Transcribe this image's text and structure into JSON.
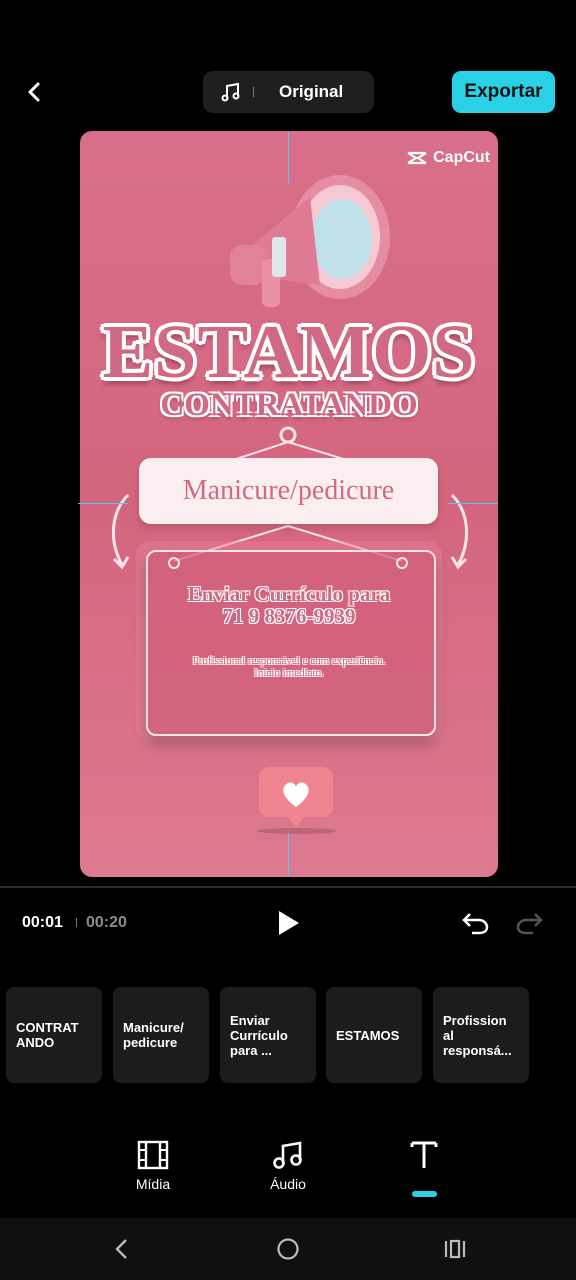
{
  "topbar": {
    "audio_label": "Original",
    "export_label": "Exportar"
  },
  "canvas": {
    "watermark": "CapCut",
    "headline": "ESTAMOS",
    "subheadline": "CONTRATANDO",
    "role": "Manicure/pedicure",
    "send_line1": "Enviar Currículo para",
    "send_line2": "71 9 8376-9939",
    "info_line1": "Profissional responsável e com experiência.",
    "info_line2": "Início imediato."
  },
  "playback": {
    "current_time": "00:01",
    "total_time": "00:20"
  },
  "clips": [
    {
      "label": "CONTRAT ANDO"
    },
    {
      "label": "Manicure/ pedicure"
    },
    {
      "label": "Enviar Currículo para ..."
    },
    {
      "label": "ESTAMOS"
    },
    {
      "label": "Profission al responsá..."
    }
  ],
  "tabs": [
    {
      "label": "Mídia",
      "icon": "film-icon"
    },
    {
      "label": "Áudio",
      "icon": "music-note-icon"
    },
    {
      "label": "",
      "icon": "text-icon"
    }
  ],
  "colors": {
    "accent": "#2ad1e6",
    "canvas_pink": "#d86f8a"
  }
}
